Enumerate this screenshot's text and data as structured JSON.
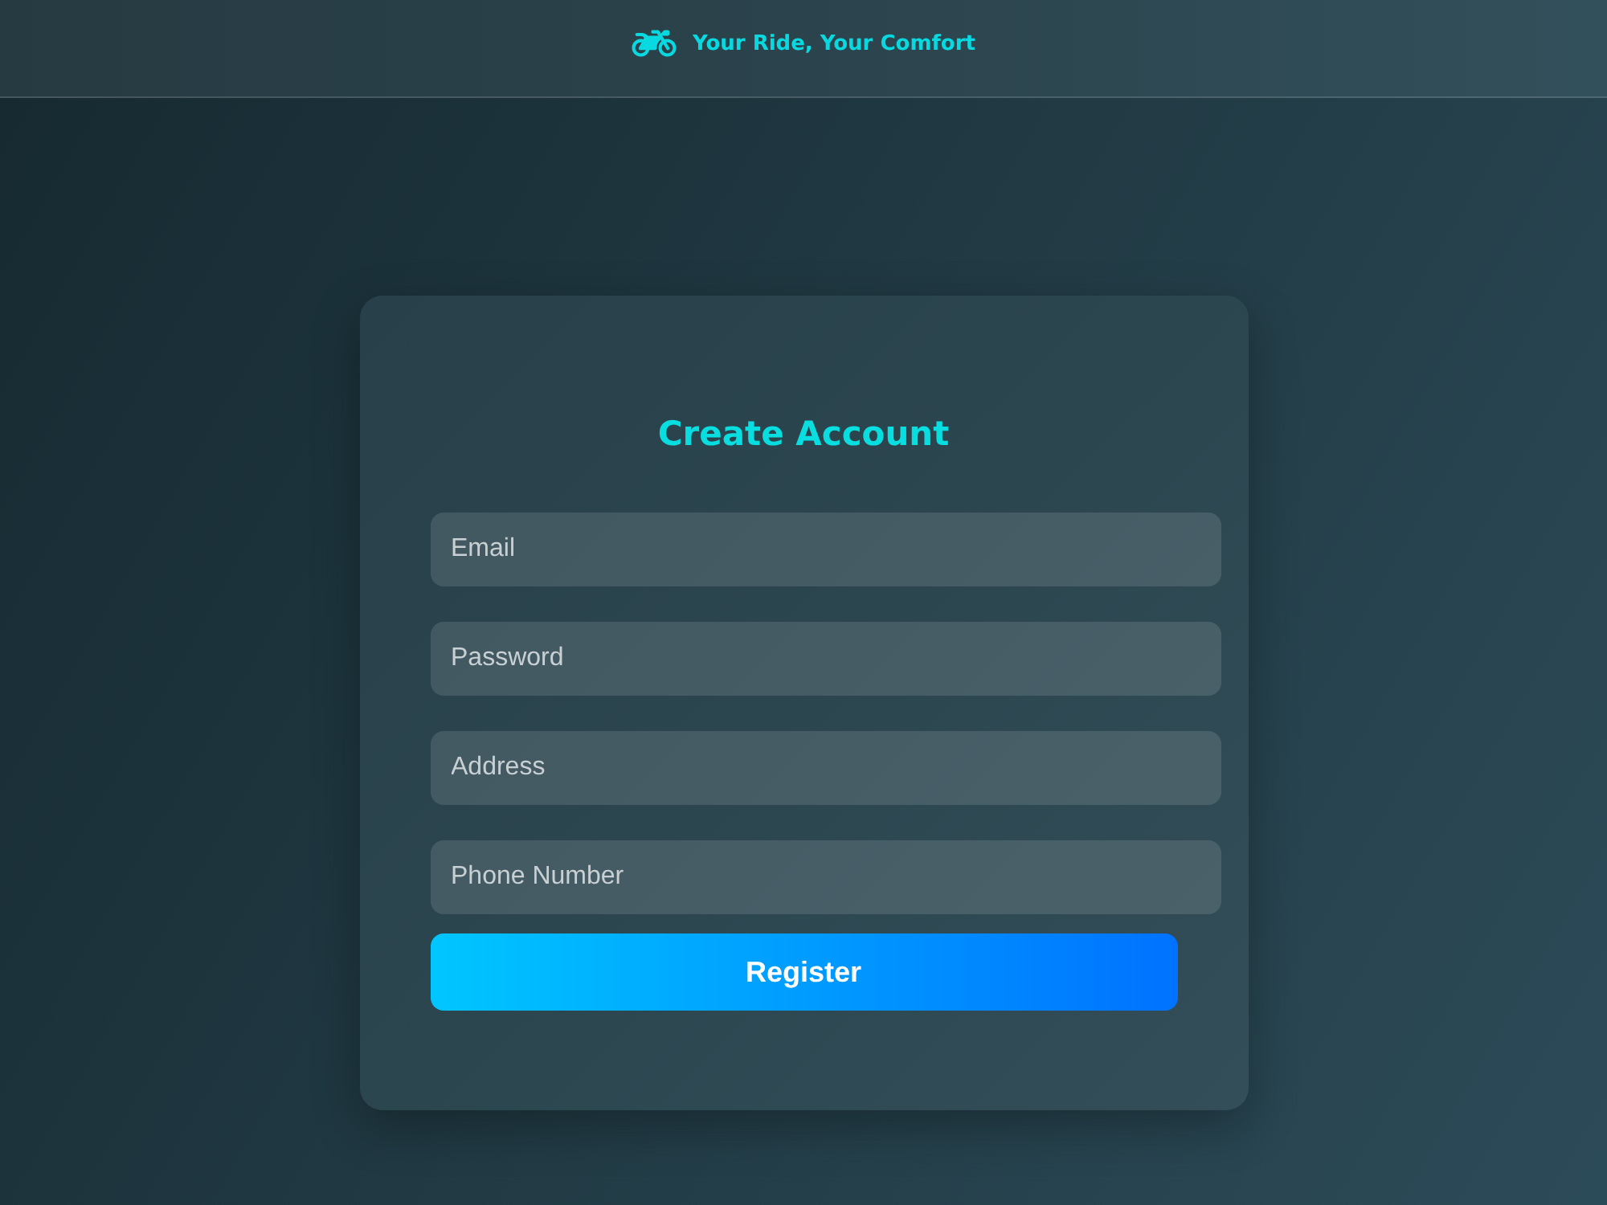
{
  "header": {
    "brand": "Your Ride, Your Comfort"
  },
  "form": {
    "title": "Create Account",
    "fields": [
      {
        "placeholder": "Email"
      },
      {
        "placeholder": "Password"
      },
      {
        "placeholder": "Address"
      },
      {
        "placeholder": "Phone Number"
      }
    ],
    "button": "Register"
  }
}
